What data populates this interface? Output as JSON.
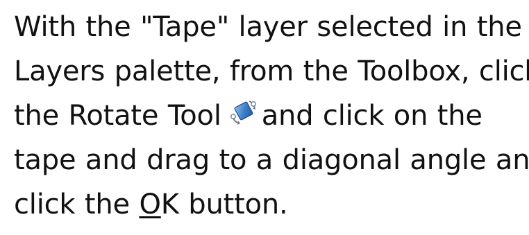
{
  "instruction": {
    "line1": "With the \"Tape\" layer selected in the",
    "line2": "Layers palette, from the Toolbox, click",
    "line3_before_icon": "the Rotate Tool",
    "line3_after_icon": "and click on the",
    "line4": "tape and drag to a diagonal angle and",
    "line5_before": "click the ",
    "line5_mnemonic": "O",
    "line5_after": "K button."
  },
  "icons": {
    "rotate_tool": "rotate-tool-icon"
  },
  "colors": {
    "text": "#111111",
    "icon_blue_dark": "#1f5fa8",
    "icon_blue_light": "#6fa8e0",
    "icon_handle": "#c9d4df"
  }
}
